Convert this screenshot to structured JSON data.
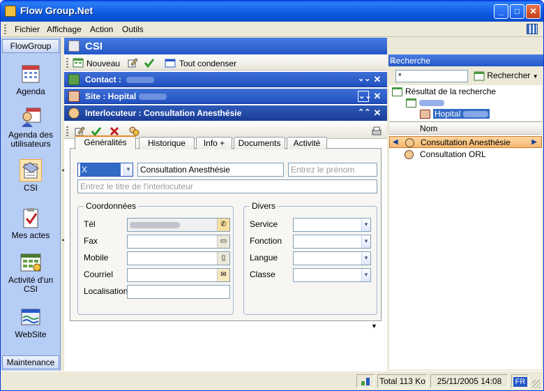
{
  "window": {
    "title": "Flow Group.Net"
  },
  "menu": [
    "Fichier",
    "Affichage",
    "Action",
    "Outils"
  ],
  "sidebar": {
    "header": "FlowGroup",
    "items": [
      {
        "label": "Agenda",
        "icon": "calendar-icon"
      },
      {
        "label": "Agenda des utilisateurs",
        "icon": "users-agenda-icon"
      },
      {
        "label": "CSI",
        "icon": "csi-icon"
      },
      {
        "label": "Mes actes",
        "icon": "checklist-icon"
      },
      {
        "label": "Activité d'un CSI",
        "icon": "activity-grid-icon"
      },
      {
        "label": "WebSite",
        "icon": "website-icon"
      }
    ],
    "footer": "Maintenance"
  },
  "center": {
    "title": "CSI",
    "toolbar": {
      "new_label": "Nouveau",
      "collapse_label": "Tout condenser"
    },
    "bands": [
      {
        "title": "Contact : "
      },
      {
        "title": "Site : Hopital"
      },
      {
        "title": "Interlocuteur : Consultation Anesthésie"
      }
    ],
    "tabs": [
      "Généralités",
      "Historique",
      "Info +",
      "Documents",
      "Activité"
    ],
    "form": {
      "civility": "X",
      "name": "Consultation Anesthésie",
      "firstname_placeholder": "Entrez le prénom",
      "title_placeholder": "Entrez le titre de l'interlocuteur",
      "coord_title": "Coordonnées",
      "divers_title": "Divers",
      "coord_labels": [
        "Tél",
        "Fax",
        "Mobile",
        "Courriel",
        "Localisation"
      ],
      "divers_labels": [
        "Service",
        "Fonction",
        "Langue",
        "Classe"
      ]
    }
  },
  "search": {
    "panel_title": "Recherche",
    "query": "*",
    "button": "Rechercher",
    "tree_root": "Résultat de la recherche",
    "tree_leaf": "Hopital",
    "column": "Nom",
    "results": [
      "Consultation Anesthésie",
      "Consultation ORL"
    ]
  },
  "status": {
    "total": "Total 113 Ko",
    "datetime": "25/11/2005 14:08",
    "lang": "FR"
  }
}
